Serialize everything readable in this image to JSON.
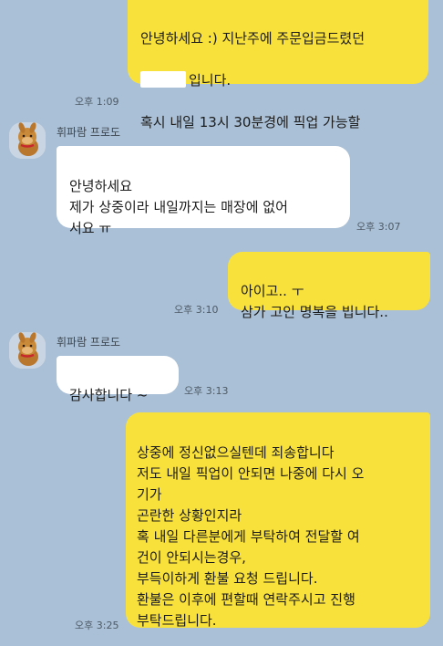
{
  "messages": [
    {
      "from": "me",
      "line1": "안녕하세요 :) 지난주에 주문입금드렸던",
      "line2_suffix": "입니다.",
      "line3": "혹시 내일 13시 30분경에 픽업 가능할",
      "line4": "까요?",
      "time": "오후 1:09"
    },
    {
      "from": "other",
      "sender": "휘파람 프로도",
      "text": "안녕하세요\n제가 상중이라 내일까지는 매장에 없어\n서요 ㅠ",
      "time": "오후 3:07"
    },
    {
      "from": "me",
      "text": "아이고.. ㅜ\n삼가 고인 명복을 빕니다..",
      "time": "오후 3:10"
    },
    {
      "from": "other",
      "sender": "휘파람 프로도",
      "text": "감사합니다 ~",
      "time": "오후 3:13"
    },
    {
      "from": "me",
      "text": "상중에 정신없으실텐데 죄송합니다\n저도 내일 픽업이 안되면 나중에 다시 오\n기가\n곤란한 상황인지라\n혹 내일 다른분에게 부탁하여 전달할 여\n건이 안되시는경우,\n부득이하게 환불 요청 드립니다.\n환불은 이후에 편할때 연락주시고 진행\n부탁드립니다.",
      "time": "오후 3:25"
    }
  ],
  "colors": {
    "background": "#aac0d6",
    "sent_bubble": "#f9e13c",
    "received_bubble": "#ffffff"
  },
  "icons": {
    "avatar": "frodo-character-avatar"
  }
}
